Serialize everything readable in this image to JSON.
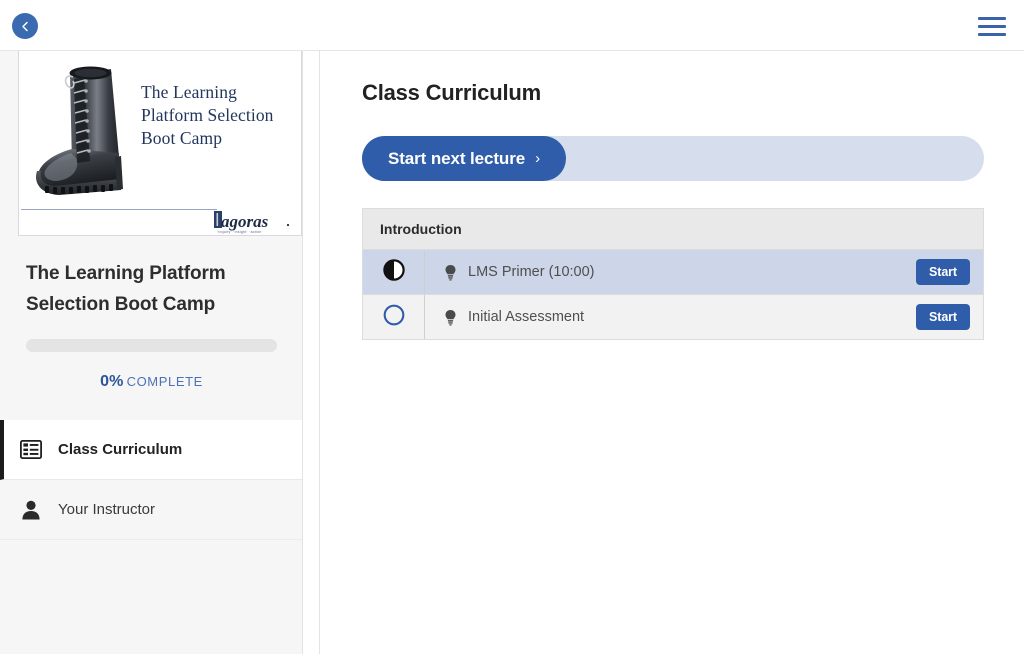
{
  "topbar": {
    "back_icon": "chevron-left-icon",
    "back_label": "Back",
    "menu_icon": "hamburger-menu-icon",
    "menu_label": "Menu"
  },
  "sidebar": {
    "course_card": {
      "image_alt": "combat-boot-photo",
      "title": "The Learning Platform Selection Boot Camp",
      "logo_text": "agoras",
      "logo_initial": "T",
      "logo_tagline": "inquiry · insight · action"
    },
    "course_title": "The Learning Platform Selection Boot Camp",
    "progress": {
      "percent": 0,
      "percent_label": "0%",
      "complete_label": "COMPLETE"
    },
    "nav_items": [
      {
        "label": "Class Curriculum",
        "icon": "list-view-icon",
        "active": true
      },
      {
        "label": "Your Instructor",
        "icon": "person-icon",
        "active": false
      }
    ]
  },
  "main": {
    "page_title": "Class Curriculum",
    "next_lecture": {
      "label": "Start next lecture",
      "chevron": "›"
    },
    "curriculum": {
      "sections": [
        {
          "title": "Introduction",
          "lessons": [
            {
              "status": "in-progress",
              "status_icon": "half-filled-circle-icon",
              "type_icon": "lightbulb-icon",
              "label": "LMS Primer (10:00)",
              "action_label": "Start",
              "highlighted": true
            },
            {
              "status": "not-started",
              "status_icon": "empty-circle-icon",
              "type_icon": "lightbulb-icon",
              "label": "Initial Assessment",
              "action_label": "Start",
              "highlighted": false
            }
          ]
        }
      ]
    }
  },
  "colors": {
    "primary_blue": "#2f5daa",
    "accent_blue": "#3a63ab",
    "track_blue": "#d6deed",
    "row_highlight": "#ccd6e8",
    "row_default": "#f2f2f2",
    "section_header": "#e9e9e9",
    "sidebar_bg": "#f6f6f6",
    "serif_navy": "#23375e"
  }
}
